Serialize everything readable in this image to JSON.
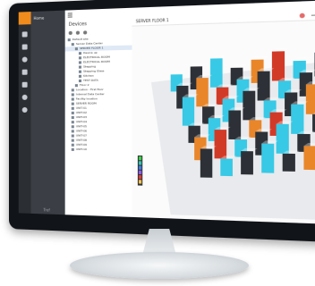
{
  "nav": {
    "title": "Home",
    "subtitle": "",
    "brand": "Tref"
  },
  "panel": {
    "title": "Devices"
  },
  "view": {
    "title": "SERVER FLOOR 1"
  },
  "tree": [
    {
      "label": "Default site",
      "indent": 0
    },
    {
      "label": "Server Data Center",
      "indent": 1
    },
    {
      "label": "SERVER FLOOR 1",
      "indent": 2,
      "selected": true
    },
    {
      "label": "Device up",
      "indent": 3
    },
    {
      "label": "ELECTRICAL ROOM",
      "indent": 3
    },
    {
      "label": "ELECTRICAL ROOM",
      "indent": 3
    },
    {
      "label": "Stepping",
      "indent": 3
    },
    {
      "label": "Stepping Glass",
      "indent": 3
    },
    {
      "label": "Kitchen",
      "indent": 3
    },
    {
      "label": "TEST DATA",
      "indent": 3
    },
    {
      "label": "Floor 2",
      "indent": 2
    },
    {
      "label": "Location - First floor",
      "indent": 1
    },
    {
      "label": "Internal Data Center",
      "indent": 1
    },
    {
      "label": "Facility location",
      "indent": 1
    },
    {
      "label": "SERVER ROOM",
      "indent": 1
    },
    {
      "label": "UNIT-01",
      "indent": 1
    },
    {
      "label": "UNIT-02",
      "indent": 1
    },
    {
      "label": "UNIT-03",
      "indent": 1
    },
    {
      "label": "UNIT-04",
      "indent": 1
    },
    {
      "label": "UNIT-05",
      "indent": 1
    },
    {
      "label": "UNIT-06",
      "indent": 1
    },
    {
      "label": "UNIT-07",
      "indent": 1
    },
    {
      "label": "UNIT-08",
      "indent": 1
    },
    {
      "label": "UNIT-09",
      "indent": 1
    },
    {
      "label": "UNIT-10",
      "indent": 1
    }
  ],
  "gauge_colors": [
    "#3ad14a",
    "#2ec4b6",
    "#3d7be0",
    "#8a5cf6",
    "#e23b3b",
    "#f2c14e"
  ],
  "colors": {
    "accent": "#f08c1c",
    "rack_cyan": "#37c9e6",
    "rack_red": "#d23a28",
    "rack_orange": "#e9862a",
    "rack_dark": "#2d3137"
  }
}
